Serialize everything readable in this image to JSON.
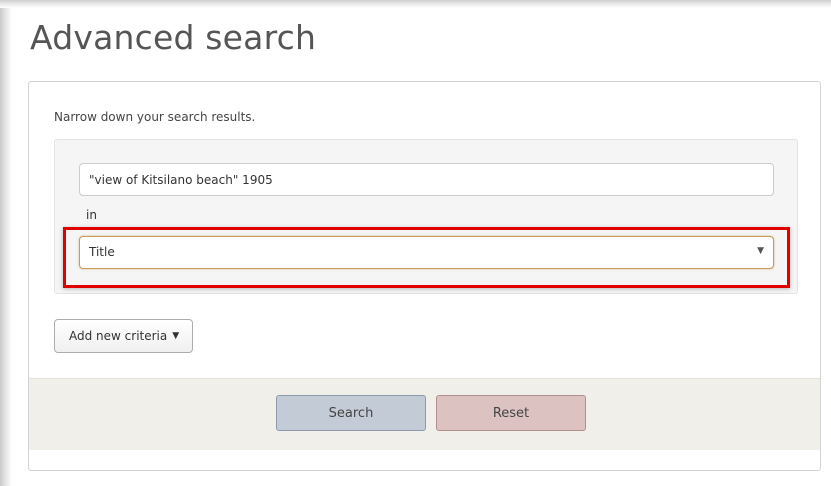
{
  "page": {
    "title": "Advanced search",
    "intro": "Narrow down your search results."
  },
  "criteria": {
    "query_value": "\"view of Kitsilano beach\" 1905",
    "in_label": "in",
    "field_selected": "Title"
  },
  "actions": {
    "add_criteria_label": "Add new criteria",
    "search_label": "Search",
    "reset_label": "Reset"
  },
  "icons": {
    "select_caret": "▼",
    "add_caret": "▼"
  },
  "colors": {
    "highlight": "#e00000",
    "search_button": "#c3cbd6",
    "reset_button": "#dcc3c2",
    "footer_bg": "#f1efea"
  }
}
